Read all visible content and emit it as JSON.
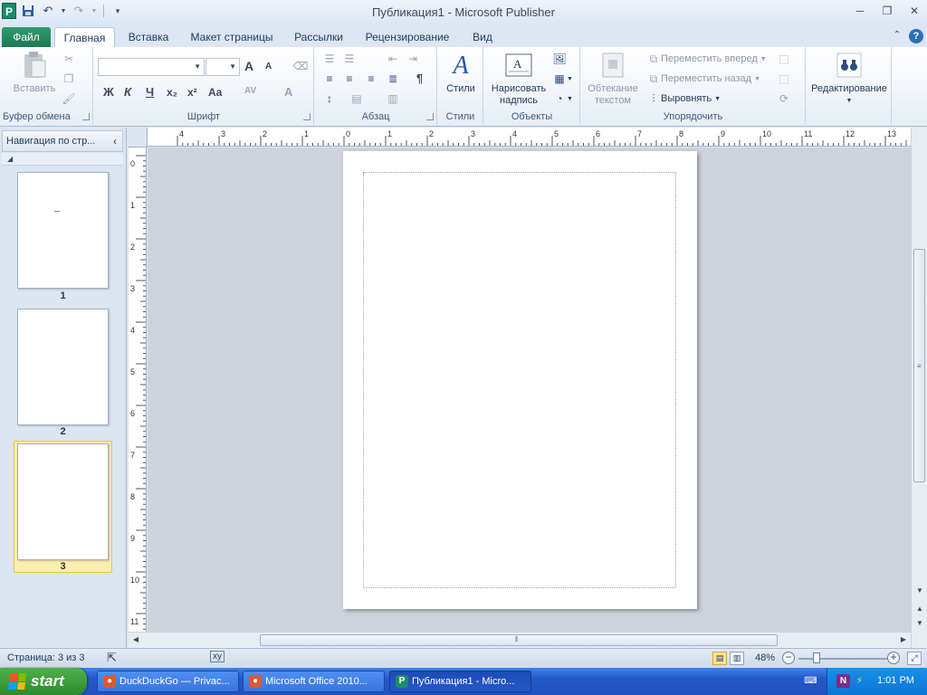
{
  "window": {
    "title": "Публикация1  -  Microsoft Publisher",
    "app_icon": "P",
    "minimize": "─",
    "restore": "❐",
    "close": "✕"
  },
  "quick_access": {
    "save_icon": "save-icon",
    "undo_icon": "undo-icon",
    "redo_icon": "redo-icon"
  },
  "tabs": {
    "file": "Файл",
    "home": "Главная",
    "insert": "Вставка",
    "page_design": "Макет страницы",
    "mailings": "Рассылки",
    "review": "Рецензирование",
    "view": "Вид",
    "help": "?"
  },
  "ribbon": {
    "clipboard": {
      "paste": "Вставить",
      "label": "Буфер обмена"
    },
    "font": {
      "label": "Шрифт",
      "bold": "Ж",
      "italic": "К",
      "underline": "Ч",
      "subscript": "x₂",
      "superscript": "x²",
      "change_case": "Aa",
      "grow": "A",
      "shrink": "A",
      "spacing": "AV",
      "color": "A"
    },
    "paragraph": {
      "label": "Абзац",
      "pilcrow": "¶"
    },
    "styles": {
      "button": "Стили",
      "label": "Стили"
    },
    "objects": {
      "draw_text_box": "Нарисовать надпись",
      "label": "Объекты"
    },
    "arrange": {
      "wrap_text": "Обтекание текстом",
      "bring_forward": "Переместить вперед",
      "send_backward": "Переместить назад",
      "align": "Выровнять",
      "label": "Упорядочить"
    },
    "editing": {
      "button": "Редактирование"
    }
  },
  "nav_pane": {
    "title": "Навигация по стр...",
    "pages": [
      {
        "number": "1"
      },
      {
        "number": "2"
      },
      {
        "number": "3"
      }
    ]
  },
  "rulers": {
    "horizontal": [
      "4",
      "3",
      "2",
      "1",
      "0",
      "1",
      "2",
      "3",
      "4",
      "5",
      "6",
      "7",
      "8",
      "9",
      "10",
      "11",
      "12",
      "13"
    ],
    "vertical": [
      "0",
      "1",
      "2",
      "3",
      "4",
      "5",
      "6",
      "7",
      "8",
      "9",
      "10",
      "11"
    ]
  },
  "status_bar": {
    "page_info": "Страница: 3 из 3",
    "zoom": "48%"
  },
  "taskbar": {
    "start": "start",
    "tasks": [
      {
        "label": "DuckDuckGo — Privac..."
      },
      {
        "label": "Microsoft Office 2010..."
      },
      {
        "label": "Публикация1 - Micro..."
      }
    ],
    "clock": "1:01 PM"
  },
  "colors": {
    "publisher_green": "#1b8c6b",
    "file_tab": "#2f9a6e",
    "selection": "#fcedb0",
    "taskbar_blue": "#2458c7"
  }
}
